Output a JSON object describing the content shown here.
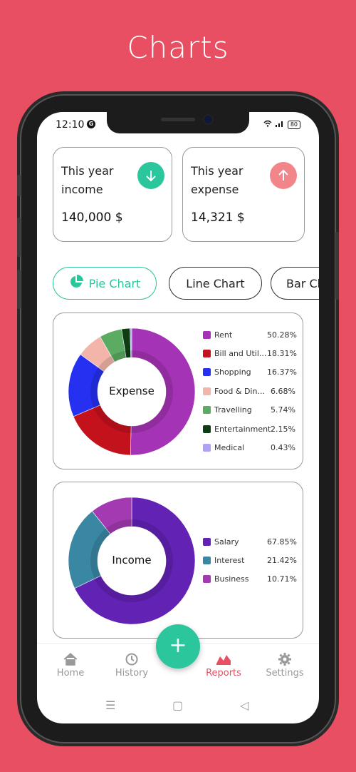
{
  "page_title": "Charts",
  "status_bar": {
    "time": "12:10",
    "battery": "80"
  },
  "cards": {
    "income": {
      "label": "This year income",
      "value": "140,000 $",
      "color": "#2bc69c"
    },
    "expense": {
      "label": "This year expense",
      "value": "14,321 $",
      "color": "#f2858a"
    }
  },
  "chart_tabs": [
    {
      "label": "Pie Chart",
      "active": true
    },
    {
      "label": "Line Chart",
      "active": false
    },
    {
      "label": "Bar Ch",
      "active": false
    }
  ],
  "chart_data": [
    {
      "type": "pie",
      "center_label": "Expense",
      "categories": [
        "Rent",
        "Bill and Util...",
        "Shopping",
        "Food & Din...",
        "Travelling",
        "Entertainment",
        "Medical"
      ],
      "values": [
        50.28,
        18.31,
        16.37,
        6.68,
        5.74,
        2.15,
        0.43
      ],
      "labels": [
        "50.28%",
        "18.31%",
        "16.37%",
        "6.68%",
        "5.74%",
        "2.15%",
        "0.43%"
      ],
      "colors": [
        "#a533b5",
        "#c4121d",
        "#2630f0",
        "#f3b4a9",
        "#5bab62",
        "#0f3b15",
        "#b1a1f5"
      ]
    },
    {
      "type": "pie",
      "center_label": "Income",
      "categories": [
        "Salary",
        "Interest",
        "Business"
      ],
      "values": [
        67.85,
        21.42,
        10.71
      ],
      "labels": [
        "67.85%",
        "21.42%",
        "10.71%"
      ],
      "colors": [
        "#6222b4",
        "#3a87a3",
        "#a33ab1"
      ]
    }
  ],
  "bottom_nav": [
    {
      "label": "Home",
      "icon": "home-icon",
      "active": false
    },
    {
      "label": "History",
      "icon": "history-icon",
      "active": false
    },
    {
      "label": "Reports",
      "icon": "reports-icon",
      "active": true
    },
    {
      "label": "Settings",
      "icon": "gear-icon",
      "active": false
    }
  ],
  "fab": {
    "label": "+"
  },
  "colors": {
    "background": "#e84f62",
    "accent": "#2bc69c"
  }
}
